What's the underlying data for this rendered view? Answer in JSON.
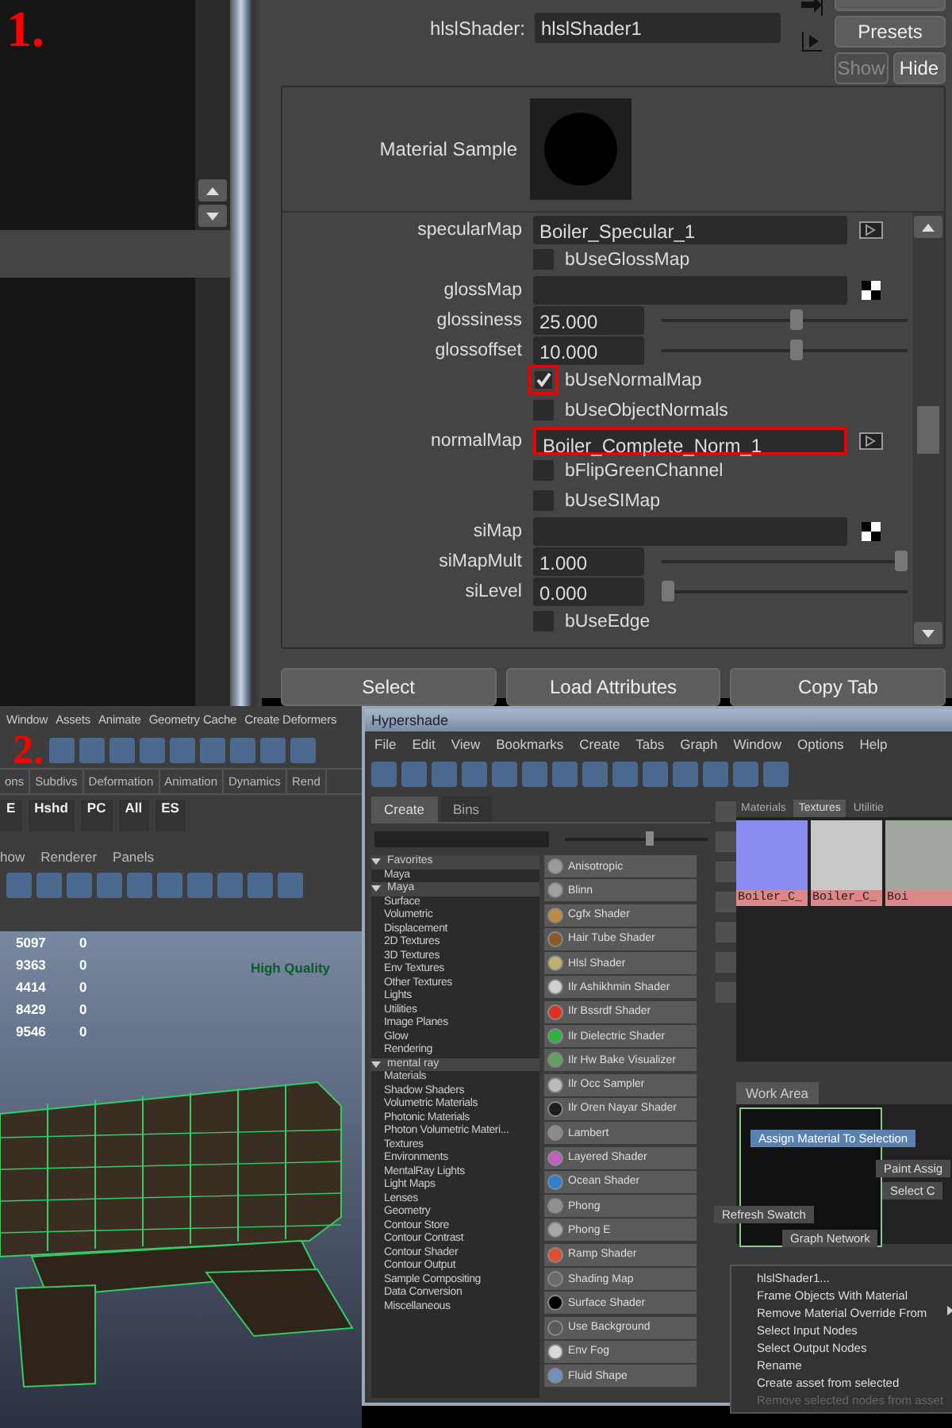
{
  "panel_1": {
    "label": "1.",
    "shader_field": {
      "label": "hlslShader:",
      "value": "hlslShader1"
    },
    "buttons": [
      {
        "label": "Presets",
        "disabled": false
      },
      {
        "label": "Show",
        "disabled": true
      },
      {
        "label": "Hide",
        "disabled": false
      }
    ],
    "material_sample": {
      "label": "Material Sample"
    },
    "attributes": [
      {
        "kind": "map",
        "label": "specularMap",
        "value": "Boiler_Specular_1",
        "connected": true,
        "highlighted": false
      },
      {
        "kind": "checkbox",
        "label": "bUseGlossMap",
        "checked": false,
        "highlighted": false
      },
      {
        "kind": "map",
        "label": "glossMap",
        "connected": false,
        "highlighted": false
      },
      {
        "kind": "slider",
        "label": "glossiness",
        "value": "25.000",
        "level": 0.55
      },
      {
        "kind": "slider",
        "label": "glossoffset",
        "value": "10.000",
        "level": 0.55
      },
      {
        "kind": "checkbox",
        "label": "bUseNormalMap",
        "checked": true,
        "highlighted": true
      },
      {
        "kind": "checkbox",
        "label": "bUseObjectNormals",
        "checked": false,
        "highlighted": false
      },
      {
        "kind": "map",
        "label": "normalMap",
        "value": "Boiler_Complete_Norm_1",
        "connected": true,
        "highlighted": true
      },
      {
        "kind": "checkbox",
        "label": "bFlipGreenChannel",
        "checked": false,
        "highlighted": false
      },
      {
        "kind": "checkbox",
        "label": "bUseSIMap",
        "checked": false,
        "highlighted": false
      },
      {
        "kind": "map",
        "label": "siMap",
        "connected": false,
        "highlighted": false
      },
      {
        "kind": "slider",
        "label": "siMapMult",
        "value": "1.000",
        "level": 1.0
      },
      {
        "kind": "slider",
        "label": "siLevel",
        "value": "0.000",
        "level": 0.0
      },
      {
        "kind": "checkbox",
        "label": "bUseEdge",
        "checked": false,
        "highlighted": false
      }
    ],
    "bottom_buttons": [
      "Select",
      "Load Attributes",
      "Copy Tab"
    ]
  },
  "panel_2": {
    "label": "2.",
    "menu": [
      "Window",
      "Assets",
      "Animate",
      "Geometry Cache",
      "Create Deformers"
    ],
    "shelf_tabs": [
      "ons",
      "Subdivs",
      "Deformation",
      "Animation",
      "Dynamics",
      "Rend"
    ],
    "shelf_items": [
      "E",
      "Hshd",
      "PC",
      "All",
      "ES"
    ],
    "viewport_menu": [
      "how",
      "Renderer",
      "Panels"
    ],
    "stats": [
      {
        "value": "5097",
        "extra": "0"
      },
      {
        "value": "9363",
        "extra": "0"
      },
      {
        "value": "4414",
        "extra": "0"
      },
      {
        "value": "8429",
        "extra": "0"
      },
      {
        "value": "9546",
        "extra": "0"
      }
    ],
    "quality_label": "High Quality",
    "hypershade": {
      "title": "Hypershade",
      "menu": [
        "File",
        "Edit",
        "View",
        "Bookmarks",
        "Create",
        "Tabs",
        "Graph",
        "Window",
        "Options",
        "Help"
      ],
      "tabs": [
        {
          "label": "Create",
          "selected": true
        },
        {
          "label": "Bins",
          "selected": false
        }
      ],
      "swatch_size": {
        "level": 0.6
      },
      "tree": [
        {
          "label": "Favorites",
          "expanded": true,
          "children": [
            {
              "label": "Maya"
            }
          ]
        },
        {
          "label": "Maya",
          "expanded": true,
          "children": [
            {
              "label": "Surface"
            },
            {
              "label": "Volumetric"
            },
            {
              "label": "Displacement"
            },
            {
              "label": "2D Textures"
            },
            {
              "label": "3D Textures"
            },
            {
              "label": "Env Textures"
            },
            {
              "label": "Other Textures"
            },
            {
              "label": "Lights"
            },
            {
              "label": "Utilities"
            },
            {
              "label": "Image Planes"
            },
            {
              "label": "Glow"
            },
            {
              "label": "Rendering"
            }
          ]
        },
        {
          "label": "mental ray",
          "expanded": true,
          "children": [
            {
              "label": "Materials"
            },
            {
              "label": "Shadow Shaders"
            },
            {
              "label": "Volumetric Materials"
            },
            {
              "label": "Photonic Materials"
            },
            {
              "label": "Photon Volumetric Materi..."
            },
            {
              "label": "Textures"
            },
            {
              "label": "Environments"
            },
            {
              "label": "MentalRay Lights"
            },
            {
              "label": "Light Maps"
            },
            {
              "label": "Lenses"
            },
            {
              "label": "Geometry"
            },
            {
              "label": "Contour Store"
            },
            {
              "label": "Contour Contrast"
            },
            {
              "label": "Contour Shader"
            },
            {
              "label": "Contour Output"
            },
            {
              "label": "Sample Compositing"
            },
            {
              "label": "Data Conversion"
            },
            {
              "label": "Miscellaneous"
            }
          ]
        }
      ],
      "shaders": [
        {
          "label": "Anisotropic",
          "color": "#9a9a9a"
        },
        {
          "label": "Blinn",
          "color": "#a0a0a0"
        },
        {
          "label": "Cgfx Shader",
          "color": "#c08a40"
        },
        {
          "label": "Hair Tube Shader",
          "color": "#8a5a2a"
        },
        {
          "label": "Hlsl Shader",
          "color": "#c0b070"
        },
        {
          "label": "Ilr Ashikhmin Shader",
          "color": "#d0d0d0"
        },
        {
          "label": "Ilr Bssrdf Shader",
          "color": "#e03020"
        },
        {
          "label": "Ilr Dielectric Shader",
          "color": "#30b040"
        },
        {
          "label": "Ilr Hw Bake Visualizer",
          "color": "#60a060"
        },
        {
          "label": "Ilr Occ Sampler",
          "color": "#bbbbbb"
        },
        {
          "label": "Ilr Oren Nayar Shader",
          "color": "#1e1e1e"
        },
        {
          "label": "Lambert",
          "color": "#8a8a8a"
        },
        {
          "label": "Layered Shader",
          "color": "#c060c0"
        },
        {
          "label": "Ocean Shader",
          "color": "#3080d0"
        },
        {
          "label": "Phong",
          "color": "#909090"
        },
        {
          "label": "Phong E",
          "color": "#a8a8a8"
        },
        {
          "label": "Ramp Shader",
          "color": "#e05030"
        },
        {
          "label": "Shading Map",
          "color": "#6a6a6a"
        },
        {
          "label": "Surface Shader",
          "color": "#000000"
        },
        {
          "label": "Use Background",
          "color": "#5a5a5a"
        },
        {
          "label": "Env Fog",
          "color": "#d8d8d8"
        },
        {
          "label": "Fluid Shape",
          "color": "#7090c0"
        }
      ],
      "texture_tabs": [
        {
          "label": "Materials",
          "selected": false
        },
        {
          "label": "Textures",
          "selected": true
        },
        {
          "label": "Utilitie",
          "selected": false
        }
      ],
      "swatches": [
        {
          "label": "Boiler_C_",
          "color": "#8a8cf0"
        },
        {
          "label": "Boiler_C_",
          "color": "#c8c8c8"
        },
        {
          "label": "Boi",
          "color": "#a0a8a0"
        }
      ],
      "work_area_tab": "Work Area",
      "marking_menu": [
        {
          "label": "Assign Material To Selection",
          "selected": true
        },
        {
          "label": "Paint Assig",
          "selected": false
        },
        {
          "label": "Select C",
          "selected": false
        },
        {
          "label": "Refresh Swatch",
          "selected": false
        },
        {
          "label": "Graph Network",
          "selected": false
        }
      ],
      "context_menu": [
        {
          "label": "hlslShader1...",
          "disabled": false,
          "submenu": false
        },
        {
          "label": "Frame Objects With Material",
          "disabled": false,
          "submenu": false
        },
        {
          "label": "Remove Material Override From",
          "disabled": false,
          "submenu": true
        },
        {
          "label": "Select Input Nodes",
          "disabled": false,
          "submenu": false
        },
        {
          "label": "Select Output Nodes",
          "disabled": false,
          "submenu": false
        },
        {
          "label": "Rename",
          "disabled": false,
          "submenu": false
        },
        {
          "label": "Create asset from selected",
          "disabled": false,
          "submenu": false
        },
        {
          "label": "Remove selected nodes from asset",
          "disabled": true,
          "submenu": false
        }
      ]
    }
  }
}
